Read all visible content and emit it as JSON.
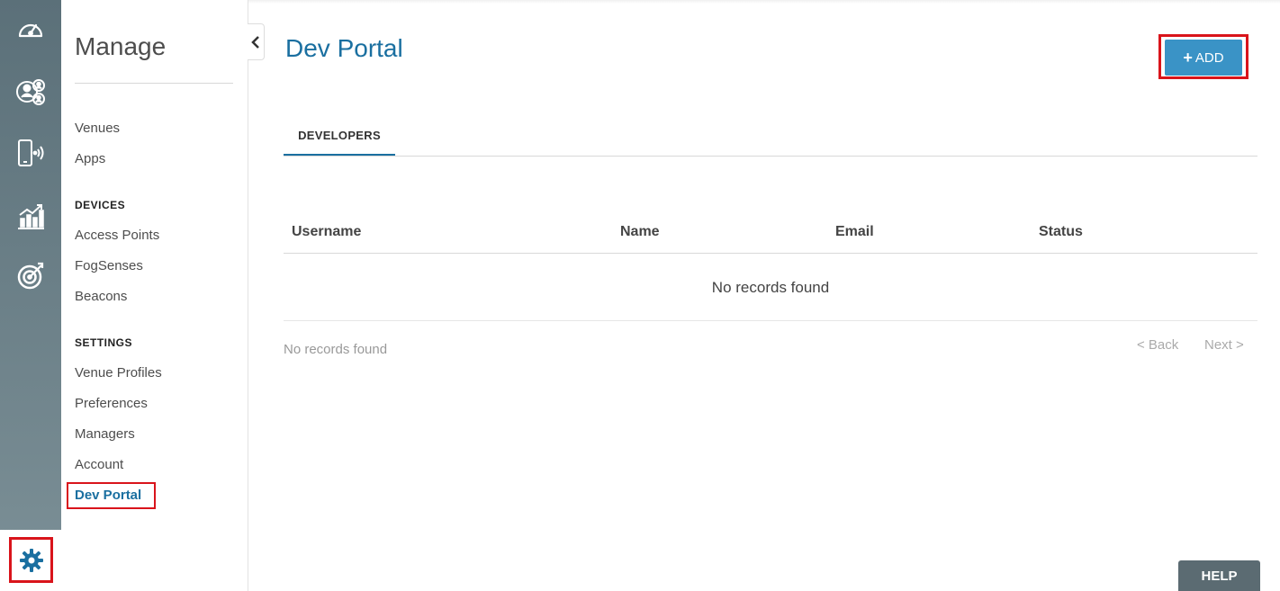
{
  "rail": {
    "icons": [
      "speedometer-icon",
      "users-icon",
      "mobile-signal-icon",
      "analytics-chart-icon",
      "target-icon"
    ],
    "bottom_icon": "gear-icon"
  },
  "sidebar": {
    "title": "Manage",
    "items_top": [
      {
        "label": "Venues"
      },
      {
        "label": "Apps"
      }
    ],
    "devices_heading": "DEVICES",
    "devices_items": [
      {
        "label": "Access Points"
      },
      {
        "label": "FogSenses"
      },
      {
        "label": "Beacons"
      }
    ],
    "settings_heading": "SETTINGS",
    "settings_items": [
      {
        "label": "Venue Profiles"
      },
      {
        "label": "Preferences"
      },
      {
        "label": "Managers"
      },
      {
        "label": "Account"
      }
    ],
    "active_item": "Dev Portal"
  },
  "main": {
    "title": "Dev Portal",
    "add_button": {
      "icon": "+",
      "label": "ADD"
    },
    "tabs": [
      {
        "label": "DEVELOPERS"
      }
    ],
    "table": {
      "columns": [
        "Username",
        "Name",
        "Email",
        "Status"
      ],
      "empty_message": "No records found"
    },
    "footer_status": "No records found",
    "pager": {
      "back": "< Back",
      "next": "Next >"
    }
  },
  "help_button": "HELP",
  "colors": {
    "accent": "#1a6fa0",
    "button": "#3a93c6",
    "highlight": "#d9141b",
    "rail_top": "#5b7079",
    "rail_bottom": "#7c9097"
  }
}
